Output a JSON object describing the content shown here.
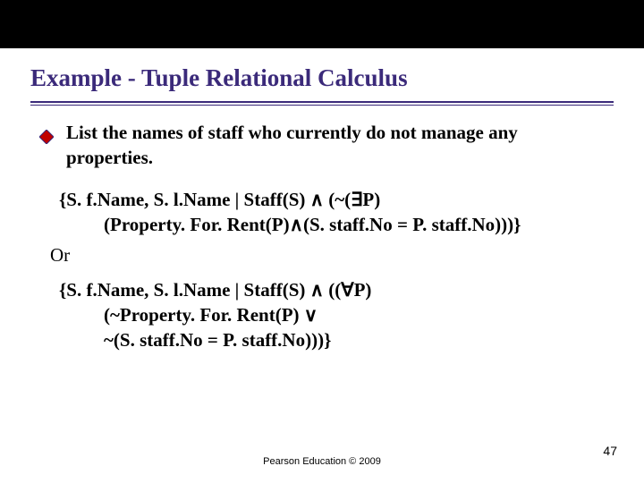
{
  "slide": {
    "title": "Example - Tuple Relational Calculus",
    "bullet": "List the names of staff who currently do not manage any properties.",
    "formula1_line1": "{S. f.Name, S. l.Name | Staff(S) ∧ (~(∃P)",
    "formula1_line2": "(Property. For. Rent(P)∧(S. staff.No = P. staff.No)))}",
    "or_label": "Or",
    "formula2_line1": "{S. f.Name, S. l.Name | Staff(S) ∧ ((∀P)",
    "formula2_line2": "(~Property. For. Rent(P) ∨",
    "formula2_line3": "~(S. staff.No = P. staff.No)))}",
    "footer": "Pearson Education © 2009",
    "page_number": "47"
  },
  "colors": {
    "heading": "#3b2a7a",
    "bullet_fill": "#c00000",
    "bullet_edge": "#3b2a7a"
  }
}
